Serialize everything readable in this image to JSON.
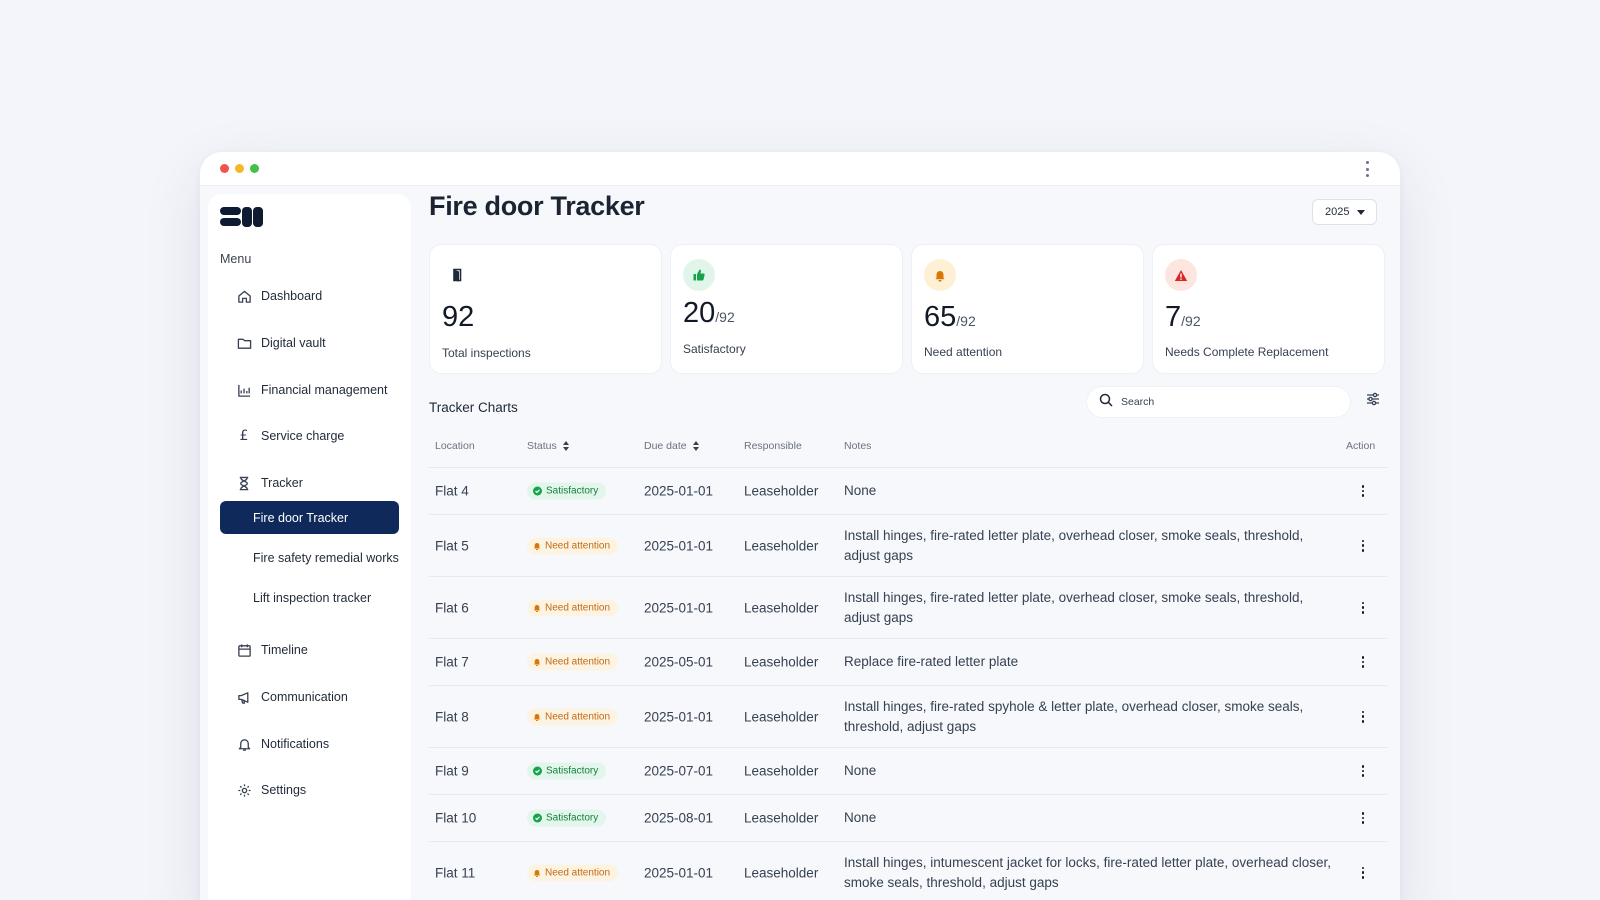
{
  "sidebar": {
    "menu_label": "Menu",
    "items": [
      {
        "label": "Dashboard",
        "icon": "home-icon"
      },
      {
        "label": "Digital vault",
        "icon": "folder-icon"
      },
      {
        "label": "Financial management",
        "icon": "chart-icon"
      },
      {
        "label": "Service charge",
        "icon": "pound-icon"
      },
      {
        "label": "Tracker",
        "icon": "hourglass-icon"
      },
      {
        "label": "Timeline",
        "icon": "calendar-icon"
      },
      {
        "label": "Communication",
        "icon": "megaphone-icon"
      },
      {
        "label": "Notifications",
        "icon": "bell-icon"
      },
      {
        "label": "Settings",
        "icon": "gear-icon"
      }
    ],
    "tracker_subitems": [
      {
        "label": "Fire door Tracker",
        "active": true
      },
      {
        "label": "Fire safety remedial works",
        "active": false
      },
      {
        "label": "Lift inspection tracker",
        "active": false
      }
    ]
  },
  "header": {
    "title": "Fire door Tracker",
    "year": "2025"
  },
  "stats": [
    {
      "value": "92",
      "of": "",
      "label": "Total inspections",
      "icon": "door-icon",
      "color": "#1f2937"
    },
    {
      "value": "20",
      "of": "/92",
      "label": "Satisfactory",
      "icon": "thumbs-up-icon",
      "color": "#16a34a"
    },
    {
      "value": "65",
      "of": "/92",
      "label": "Need attention",
      "icon": "bell-icon",
      "color": "#d97706"
    },
    {
      "value": "7",
      "of": "/92",
      "label": "Needs Complete Replacement",
      "icon": "warning-icon",
      "color": "#dc2626"
    }
  ],
  "tracker": {
    "title": "Tracker Charts",
    "search_placeholder": "Search",
    "columns": {
      "location": "Location",
      "status": "Status",
      "due_date": "Due date",
      "responsible": "Responsible",
      "notes": "Notes",
      "action": "Action"
    },
    "rows": [
      {
        "location": "Flat 4",
        "status": "Satisfactory",
        "due": "2025-01-01",
        "responsible": "Leaseholder",
        "notes": "None"
      },
      {
        "location": "Flat 5",
        "status": "Need attention",
        "due": "2025-01-01",
        "responsible": "Leaseholder",
        "notes": "Install hinges, fire-rated letter plate, overhead closer, smoke seals, threshold, adjust gaps"
      },
      {
        "location": "Flat 6",
        "status": "Need attention",
        "due": "2025-01-01",
        "responsible": "Leaseholder",
        "notes": "Install hinges, fire-rated letter plate, overhead closer, smoke seals, threshold, adjust gaps"
      },
      {
        "location": "Flat 7",
        "status": "Need attention",
        "due": "2025-05-01",
        "responsible": "Leaseholder",
        "notes": "Replace fire-rated letter plate"
      },
      {
        "location": "Flat 8",
        "status": "Need attention",
        "due": "2025-01-01",
        "responsible": "Leaseholder",
        "notes": "Install hinges, fire-rated spyhole & letter plate, overhead closer, smoke seals, threshold, adjust gaps"
      },
      {
        "location": "Flat 9",
        "status": "Satisfactory",
        "due": "2025-07-01",
        "responsible": "Leaseholder",
        "notes": "None"
      },
      {
        "location": "Flat 10",
        "status": "Satisfactory",
        "due": "2025-08-01",
        "responsible": "Leaseholder",
        "notes": "None"
      },
      {
        "location": "Flat 11",
        "status": "Need attention",
        "due": "2025-01-01",
        "responsible": "Leaseholder",
        "notes": "Install hinges, intumescent jacket for locks, fire-rated letter plate, overhead closer, smoke seals, threshold, adjust gaps"
      }
    ]
  }
}
